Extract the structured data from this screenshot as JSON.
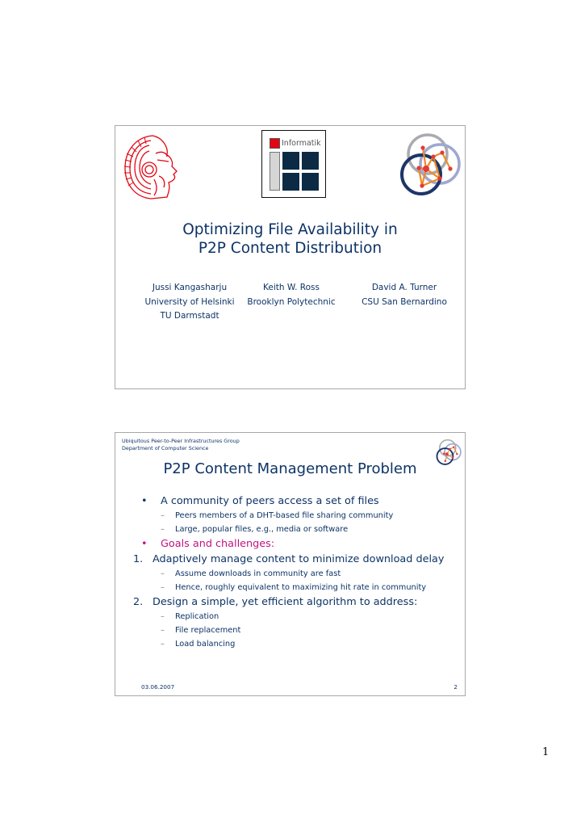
{
  "slides": [
    {
      "logos": {
        "left": "tu-darmstadt-athena-logo",
        "center": {
          "text": "Informatik"
        },
        "right": "ubiquitous-p2p-network-logo"
      },
      "title_line1": "Optimizing File Availability in",
      "title_line2": "P2P Content Distribution",
      "authors": [
        {
          "name": "Jussi Kangasharju",
          "affiliation": "University of Helsinki",
          "affiliation2": "TU Darmstadt"
        },
        {
          "name": "Keith W. Ross",
          "affiliation": "Brooklyn Polytechnic",
          "affiliation2": ""
        },
        {
          "name": "David A. Turner",
          "affiliation": "CSU San Bernardino",
          "affiliation2": ""
        }
      ]
    },
    {
      "header_line1": "Ubiquitous Peer-to-Peer Infrastructures Group",
      "header_line2": "Department of Computer Science",
      "title": "P2P Content Management Problem",
      "bullets": [
        {
          "marker": "•",
          "text": "A community of peers access a set of files",
          "style": "normal",
          "sub": [
            "Peers members of a DHT-based file sharing community",
            "Large, popular files, e.g., media or software"
          ]
        },
        {
          "marker": "•",
          "text": "Goals and challenges:",
          "style": "magenta",
          "sub": []
        },
        {
          "marker": "1.",
          "text": "Adaptively manage content to minimize download delay",
          "style": "normal",
          "sub": [
            "Assume downloads in community are fast",
            "Hence, roughly equivalent to maximizing hit rate in community"
          ]
        },
        {
          "marker": "2.",
          "text": "Design a simple, yet efficient algorithm to address:",
          "style": "normal",
          "sub": [
            "Replication",
            "File replacement",
            "Load balancing"
          ]
        }
      ],
      "sub_marker": "–",
      "footer_date": "03.06.2007",
      "footer_page": "2"
    }
  ],
  "page_number": "1",
  "colors": {
    "text_navy": "#0d3366",
    "accent_magenta": "#c0137f",
    "logo_red": "#e30613",
    "logo_dark": "#0c2a44"
  }
}
